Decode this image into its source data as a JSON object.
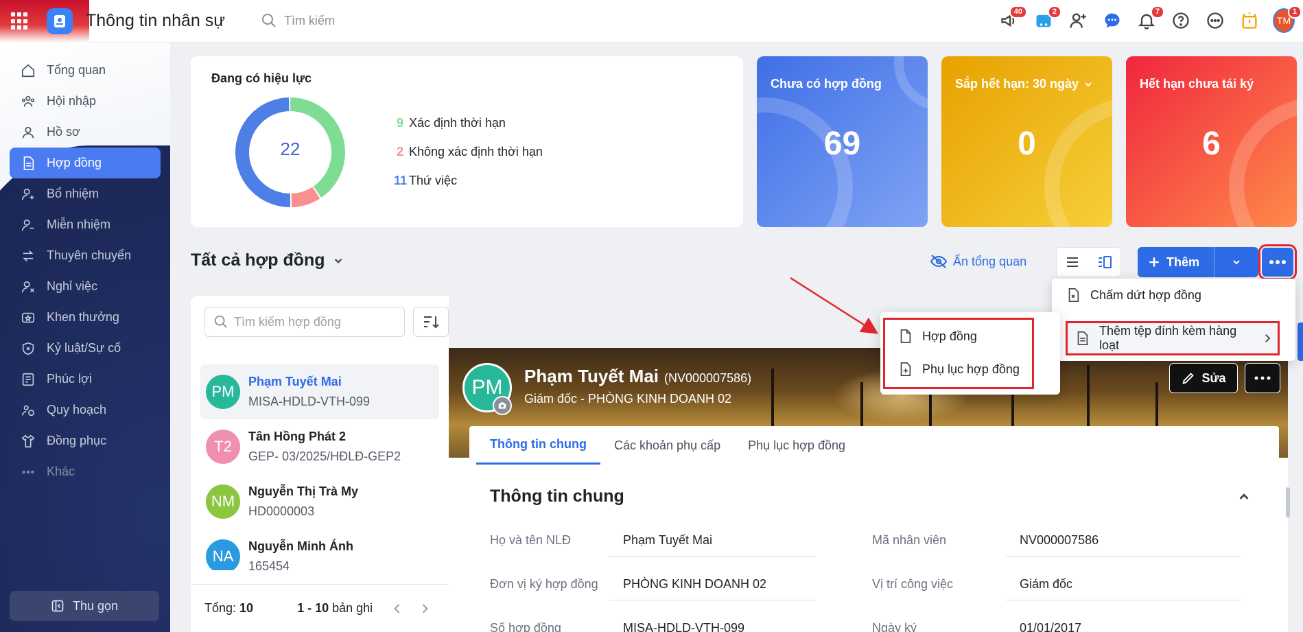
{
  "app": {
    "title": "Thông tin nhân sự",
    "search_placeholder": "Tìm kiếm"
  },
  "top_badges": {
    "megaphone": "40",
    "cart": "2",
    "bell": "7",
    "avatar": "1"
  },
  "avatar_initials": "TM",
  "sidebar": {
    "items": [
      {
        "label": "Tổng quan",
        "icon": "home-icon"
      },
      {
        "label": "Hội nhập",
        "icon": "users-icon"
      },
      {
        "label": "Hồ sơ",
        "icon": "user-icon"
      },
      {
        "label": "Hợp đồng",
        "icon": "document-icon",
        "active": true
      },
      {
        "label": "Bổ nhiệm",
        "icon": "user-plus-icon"
      },
      {
        "label": "Miễn nhiệm",
        "icon": "user-minus-icon"
      },
      {
        "label": "Thuyên chuyển",
        "icon": "transfer-icon"
      },
      {
        "label": "Nghỉ việc",
        "icon": "user-x-icon"
      },
      {
        "label": "Khen thưởng",
        "icon": "award-icon"
      },
      {
        "label": "Kỷ luật/Sự cố",
        "icon": "shield-icon"
      },
      {
        "label": "Phúc lợi",
        "icon": "benefit-icon"
      },
      {
        "label": "Quy hoạch",
        "icon": "planning-icon"
      },
      {
        "label": "Đồng phục",
        "icon": "shirt-icon"
      },
      {
        "label": "Khác",
        "icon": "more-icon"
      }
    ],
    "collapse_label": "Thu gọn"
  },
  "summary": {
    "title": "Đang có hiệu lực",
    "total": "22",
    "legend": [
      {
        "count": "9",
        "label": "Xác định thời hạn",
        "color": "#7fdc94"
      },
      {
        "count": "2",
        "label": "Không xác định thời hạn",
        "color": "#f98f8f"
      },
      {
        "count": "11",
        "label": "Thứ việc",
        "color": "#4d7fe6"
      }
    ]
  },
  "stats": [
    {
      "title": "Chưa có hợp đồng",
      "value": "69"
    },
    {
      "title": "Sắp hết hạn: 30 ngày",
      "value": "0"
    },
    {
      "title": "Hết hạn chưa tái ký",
      "value": "6"
    }
  ],
  "list_header": {
    "title": "Tất cả hợp đồng",
    "hide_overview": "Ẩn tổng quan",
    "add_label": "Thêm"
  },
  "menu": {
    "terminate": "Chấm dứt hợp đồng",
    "bulk_attach": "Thêm tệp đính kèm hàng loạt",
    "sub_contract": "Hợp đồng",
    "sub_appendix": "Phụ lục hợp đồng"
  },
  "contract_search_placeholder": "Tìm kiếm hợp đồng",
  "employees": [
    {
      "initials": "PM",
      "name": "Phạm Tuyết Mai",
      "code": "MISA-HDLD-VTH-099",
      "color": "#27b89a"
    },
    {
      "initials": "T2",
      "name": "Tân Hồng Phát 2",
      "code": "GEP- 03/2025/HĐLĐ-GEP2",
      "color": "#f08fae"
    },
    {
      "initials": "NM",
      "name": "Nguyễn Thị Trà My",
      "code": "HD0000003",
      "color": "#8cc63f"
    },
    {
      "initials": "NA",
      "name": "Nguyễn Minh Ánh",
      "code": "165454",
      "color": "#2a9be0"
    }
  ],
  "footer": {
    "total_label": "Tổng:",
    "total": "10",
    "range": "1 - 10",
    "range_suffix": "bản ghi"
  },
  "detail": {
    "initials": "PM",
    "name": "Phạm Tuyết Mai",
    "emp_code": "(NV000007586)",
    "role": "Giám đốc - PHÒNG KINH DOANH 02",
    "edit_label": "Sửa",
    "tabs": [
      "Thông tin chung",
      "Các khoản phụ cấp",
      "Phụ lục hợp đồng"
    ],
    "section_title": "Thông tin chung",
    "fields": [
      {
        "label": "Họ và tên NLĐ",
        "value": "Phạm Tuyết Mai"
      },
      {
        "label": "Mã nhân viên",
        "value": "NV000007586"
      },
      {
        "label": "Đơn vị ký hợp đồng",
        "value": "PHÒNG KINH DOANH 02"
      },
      {
        "label": "Vị trí công việc",
        "value": "Giám đốc"
      },
      {
        "label": "Số hợp đồng",
        "value": "MISA-HDLD-VTH-099"
      },
      {
        "label": "Ngày ký",
        "value": "01/01/2017"
      }
    ]
  }
}
